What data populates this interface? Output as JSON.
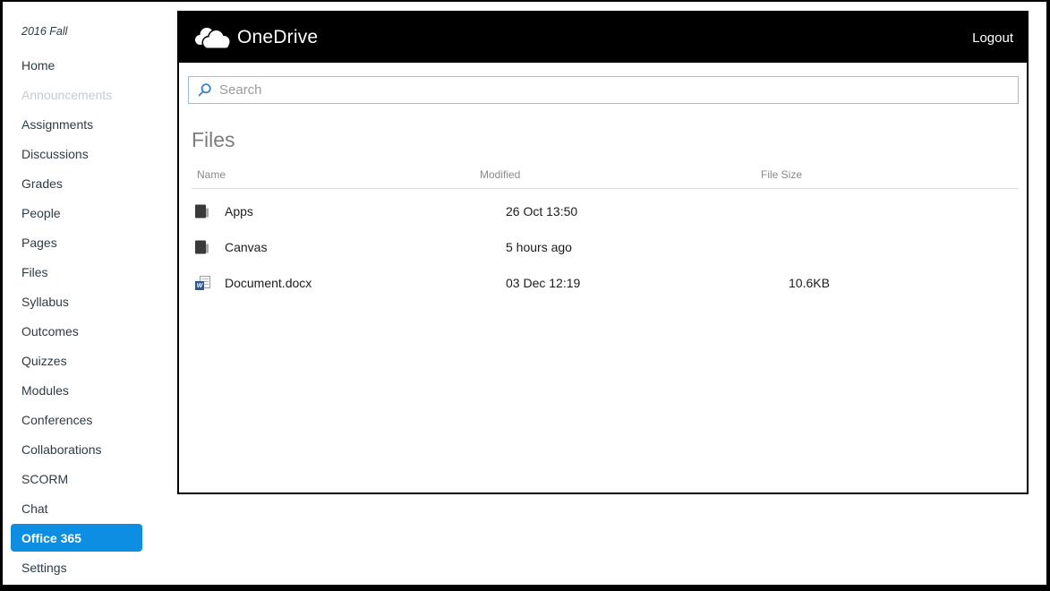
{
  "sidebar": {
    "course_label": "2016 Fall",
    "items": [
      {
        "label": "Home",
        "state": "normal"
      },
      {
        "label": "Announcements",
        "state": "disabled"
      },
      {
        "label": "Assignments",
        "state": "normal"
      },
      {
        "label": "Discussions",
        "state": "normal"
      },
      {
        "label": "Grades",
        "state": "normal"
      },
      {
        "label": "People",
        "state": "normal"
      },
      {
        "label": "Pages",
        "state": "normal"
      },
      {
        "label": "Files",
        "state": "normal"
      },
      {
        "label": "Syllabus",
        "state": "normal"
      },
      {
        "label": "Outcomes",
        "state": "normal"
      },
      {
        "label": "Quizzes",
        "state": "normal"
      },
      {
        "label": "Modules",
        "state": "normal"
      },
      {
        "label": "Conferences",
        "state": "normal"
      },
      {
        "label": "Collaborations",
        "state": "normal"
      },
      {
        "label": "SCORM",
        "state": "normal"
      },
      {
        "label": "Chat",
        "state": "normal"
      },
      {
        "label": "Office 365",
        "state": "active"
      },
      {
        "label": "Settings",
        "state": "normal"
      }
    ]
  },
  "onedrive": {
    "app_title": "OneDrive",
    "logout_label": "Logout",
    "search": {
      "placeholder": "Search",
      "value": ""
    },
    "heading": "Files",
    "table": {
      "columns": {
        "name": "Name",
        "modified": "Modified",
        "size": "File Size"
      },
      "rows": [
        {
          "name": "Apps",
          "icon": "folder-icon",
          "modified": "26 Oct 13:50",
          "size": ""
        },
        {
          "name": "Canvas",
          "icon": "folder-icon",
          "modified": "5 hours ago",
          "size": ""
        },
        {
          "name": "Document.docx",
          "icon": "word-file-icon",
          "modified": "03 Dec 12:19",
          "size": "10.6KB"
        }
      ]
    }
  },
  "colors": {
    "accent_blue": "#0E8EE2",
    "search_border": "#9EBFDF",
    "search_icon_blue": "#2E7CC4",
    "header_bg": "#000000"
  }
}
